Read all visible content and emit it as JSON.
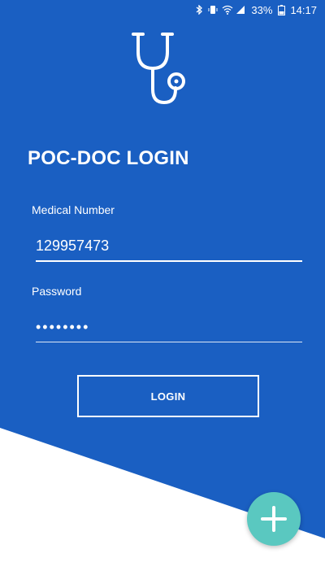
{
  "status_bar": {
    "bluetooth_icon": "bluetooth-icon",
    "vibrate_icon": "vibrate-icon",
    "wifi_icon": "wifi-icon",
    "signal_icon": "signal-icon",
    "battery_percent": "33%",
    "battery_icon": "battery-icon",
    "time": "14:17"
  },
  "logo": {
    "icon": "stethoscope-icon"
  },
  "login": {
    "title": "POC-DOC LOGIN",
    "medical_number_label": "Medical Number",
    "medical_number_value": "129957473",
    "password_label": "Password",
    "password_value": "••••••••",
    "button_label": "LOGIN"
  },
  "fab": {
    "icon": "plus-icon"
  },
  "colors": {
    "primary_blue": "#1a5fc2",
    "fab_teal": "#5ac8c0",
    "text": "#ffffff"
  }
}
